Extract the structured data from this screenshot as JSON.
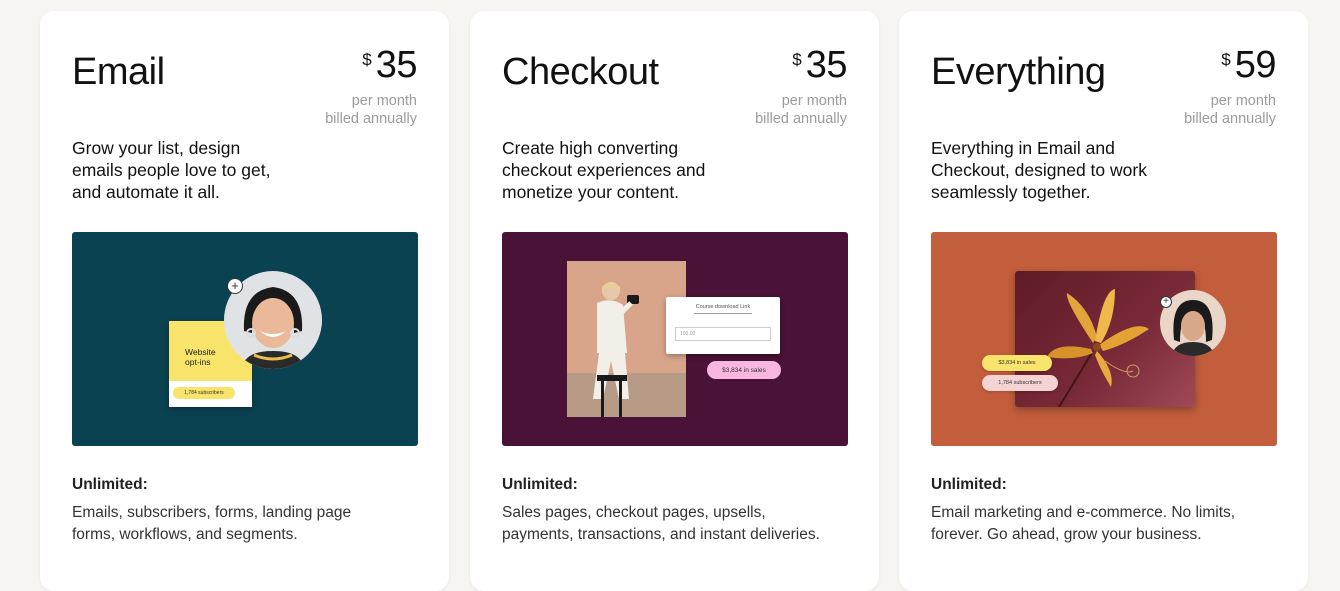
{
  "plans": [
    {
      "title": "Email",
      "currency": "$",
      "price": "35",
      "period_line1": "per month",
      "period_line2": "billed annually",
      "desc_lines": [
        "Grow your list, design",
        "emails people love to get,",
        "and automate it all."
      ],
      "illus": {
        "bg": "#0b4252",
        "card_label_1": "Website",
        "card_label_2": "opt-ins",
        "pill_text": "1,784 subscribers"
      },
      "unlimited_label": "Unlimited:",
      "unlimited_lines": [
        "Emails, subscribers, forms, landing page",
        "forms, workflows, and segments."
      ]
    },
    {
      "title": "Checkout",
      "currency": "$",
      "price": "35",
      "period_line1": "per month",
      "period_line2": "billed annually",
      "desc_lines": [
        "Create high converting",
        "checkout experiences and",
        "monetize your content."
      ],
      "illus": {
        "bg": "#4a1236",
        "form_title": "Course download Link",
        "form_input": "100.00",
        "pill_text": "$3,834 in sales"
      },
      "unlimited_label": "Unlimited:",
      "unlimited_lines": [
        "Sales pages, checkout pages, upsells,",
        "payments, transactions, and instant deliveries."
      ]
    },
    {
      "title": "Everything",
      "currency": "$",
      "price": "59",
      "period_line1": "per month",
      "period_line2": "billed annually",
      "desc_lines": [
        "Everything in Email and",
        "Checkout, designed to work",
        "seamlessly together."
      ],
      "illus": {
        "bg": "#c35e3c",
        "pill_text_1": "$3,834 in sales",
        "pill_text_2": "1,784 subscribers"
      },
      "unlimited_label": "Unlimited:",
      "unlimited_lines": [
        "Email marketing and e-commerce. No limits,",
        "forever. Go ahead, grow your business."
      ]
    }
  ]
}
